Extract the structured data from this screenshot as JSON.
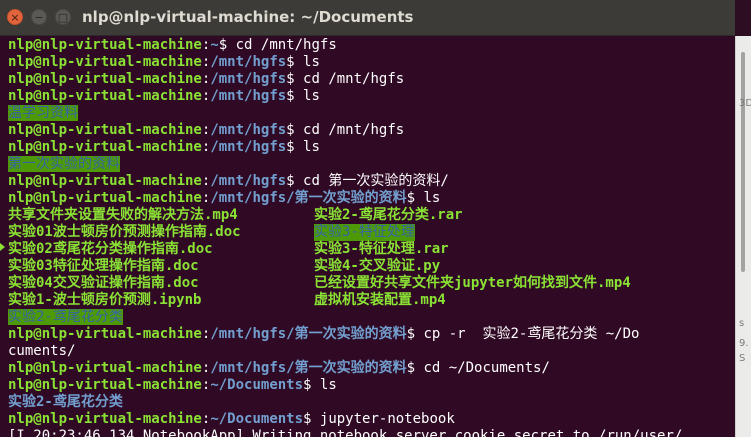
{
  "window": {
    "title": "nlp@nlp-virtual-machine: ~/Documents",
    "close_glyph": "×",
    "minimize_glyph": "−",
    "maximize_glyph": "□"
  },
  "colors": {
    "terminal_bg": "#300a24",
    "user_host": "#8ae234",
    "path": "#729fcf",
    "text": "#ffffff",
    "highlight_bg": "#4e9a06",
    "highlight_fg": "#3465a4",
    "titlebar": "#3c3b37"
  },
  "prompt": {
    "user_host": "nlp@nlp-virtual-machine",
    "sep": ":",
    "path_home": "~",
    "path_hgfs": "/mnt/hgfs",
    "path_hgfs_base": "/mnt/hgfs/",
    "folder_first": "第一次实验的资料",
    "path_docs": "~/Documents",
    "dollar": "$ "
  },
  "commands": {
    "c1": "cd /mnt/hgfs",
    "c2": "ls",
    "c3": "cd /mnt/hgfs",
    "c4": "ls",
    "c5": "cd /mnt/hgfs",
    "c6": "ls",
    "c7": "cd 第一次实验的资料/",
    "c8": "ls",
    "c9": "cp -r  实验2-鸢尾花分类 ~/Do",
    "c9b": "cuments/",
    "c10": "cd ~/Documents/",
    "c11": "ls",
    "c12": "jupyter-notebook"
  },
  "outputs": {
    "hgfs_1": "温学习资料",
    "hgfs_2": "第一次实验的资料",
    "ls_col1": [
      "共享文件夹设置失败的解决方法.mp4",
      "实验01波士顿房价预测操作指南.doc",
      "实验02鸢尾花分类操作指南.doc",
      "实验03特征处理操作指南.doc",
      "实验04交叉验证操作指南.doc",
      "实验1-波士顿房价预测.ipynb",
      "实验2-鸢尾花分类"
    ],
    "ls_col2": [
      "实验2-鸢尾花分类.rar",
      "实验3-特征处理",
      "实验3-特征处理.rar",
      "实验4-交叉验证.py",
      "已经设置好共享文件夹jupyter如何找到文件.mp4",
      "虚拟机安装配置.mp4"
    ],
    "docs_ls": "实验2-鸢尾花分类",
    "log": "[I 20:23:46.134 NotebookApp] Writing notebook server cookie secret to /run/user/"
  },
  "background_fragments": {
    "f1": "3D",
    "f2": "s",
    "f3": "9.",
    "f4": "S"
  }
}
